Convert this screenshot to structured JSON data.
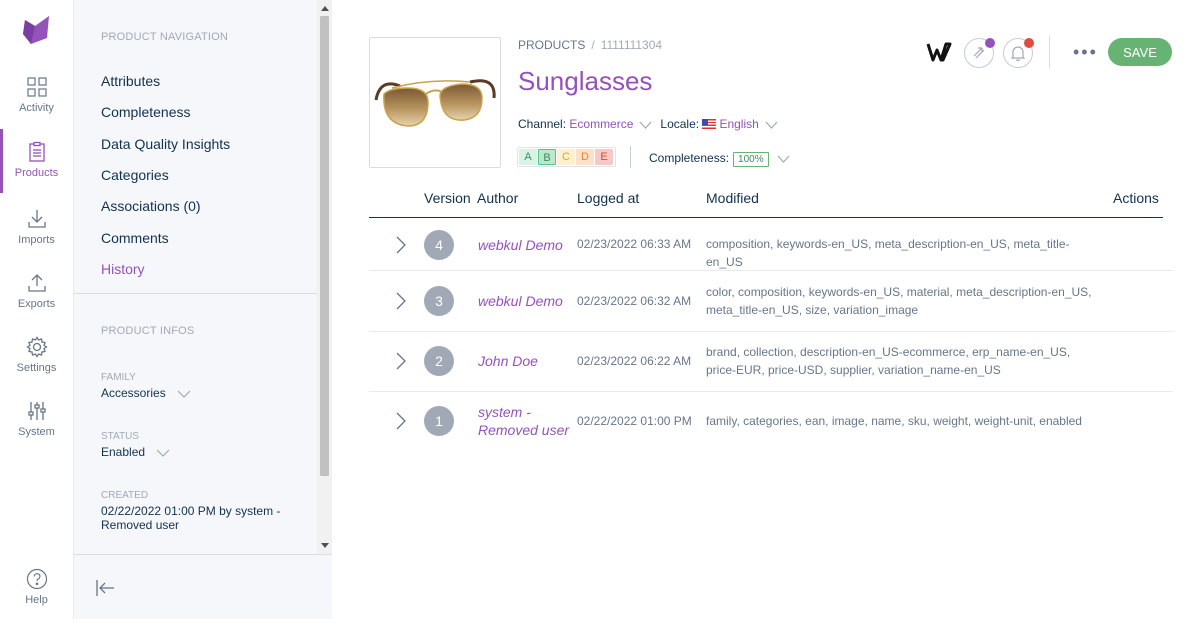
{
  "main_menu": {
    "items": [
      {
        "label": "Activity",
        "icon": "activity-icon",
        "active": false
      },
      {
        "label": "Products",
        "icon": "products-icon",
        "active": true
      },
      {
        "label": "Imports",
        "icon": "imports-icon",
        "active": false
      },
      {
        "label": "Exports",
        "icon": "exports-icon",
        "active": false
      },
      {
        "label": "Settings",
        "icon": "settings-icon",
        "active": false
      },
      {
        "label": "System",
        "icon": "system-icon",
        "active": false
      }
    ],
    "help_label": "Help"
  },
  "product_nav": {
    "title": "PRODUCT NAVIGATION",
    "links": [
      {
        "label": "Attributes"
      },
      {
        "label": "Completeness"
      },
      {
        "label": "Data Quality Insights"
      },
      {
        "label": "Categories"
      },
      {
        "label": "Associations (0)"
      },
      {
        "label": "Comments"
      },
      {
        "label": "History",
        "active": true
      }
    ],
    "infos_title": "PRODUCT INFOS",
    "family": {
      "label": "FAMILY",
      "value": "Accessories"
    },
    "status": {
      "label": "STATUS",
      "value": "Enabled"
    },
    "created": {
      "label": "CREATED",
      "value": "02/22/2022 01:00 PM by system - Removed user"
    }
  },
  "header": {
    "breadcrumb_root": "PRODUCTS",
    "breadcrumb_separator": "/",
    "product_code": "1111111304",
    "title": "Sunglasses",
    "channel_label": "Channel:",
    "channel_value": "Ecommerce",
    "locale_label": "Locale:",
    "locale_value": "English",
    "dqi_grades": [
      "A",
      "B",
      "C",
      "D",
      "E"
    ],
    "dqi_selected": "B",
    "completeness_label": "Completeness:",
    "completeness_value": "100%",
    "save_label": "SAVE",
    "colors": {
      "accent": "#9452ba",
      "save": "#67b373",
      "notification_dot": "#e04b3f",
      "sync_dot": "#9452ba"
    }
  },
  "history": {
    "columns": {
      "version": "Version",
      "author": "Author",
      "logged_at": "Logged at",
      "modified": "Modified",
      "actions": "Actions"
    },
    "rows": [
      {
        "version": "4",
        "author": "webkul Demo",
        "logged_at": "02/23/2022 06:33 AM",
        "modified": "composition, keywords-en_US, meta_description-en_US, meta_title-en_US"
      },
      {
        "version": "3",
        "author": "webkul Demo",
        "logged_at": "02/23/2022 06:32 AM",
        "modified": "color, composition, keywords-en_US, material, meta_description-en_US, meta_title-en_US, size, variation_image"
      },
      {
        "version": "2",
        "author": "John Doe",
        "logged_at": "02/23/2022 06:22 AM",
        "modified": "brand, collection, description-en_US-ecommerce, erp_name-en_US, price-EUR, price-USD, supplier, variation_name-en_US"
      },
      {
        "version": "1",
        "author": "system - Removed user",
        "logged_at": "02/22/2022 01:00 PM",
        "modified": "family, categories, ean, image, name, sku, weight, weight-unit, enabled"
      }
    ]
  }
}
